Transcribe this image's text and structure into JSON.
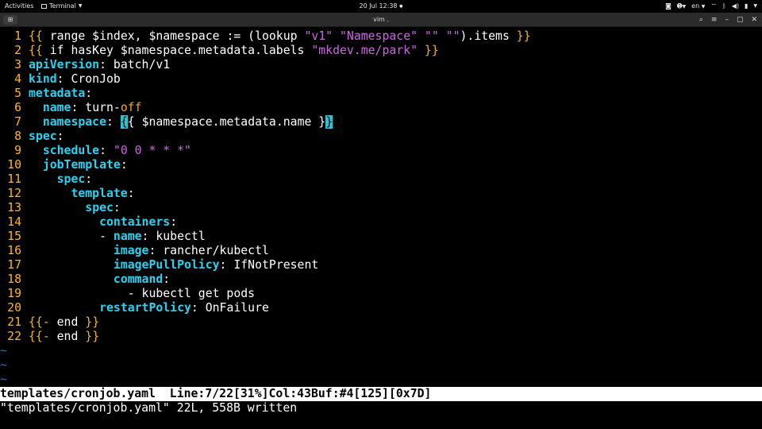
{
  "topbar": {
    "activities": "Activities",
    "app_menu": "Terminal",
    "clock": "20 Jul  12:38",
    "clock_dot": "●",
    "lang": "en"
  },
  "terminal": {
    "title": "vim ."
  },
  "editor": {
    "line_numbers": [
      "1",
      "2",
      "3",
      "4",
      "5",
      "6",
      "7",
      "8",
      "9",
      "10",
      "11",
      "12",
      "13",
      "14",
      "15",
      "16",
      "17",
      "18",
      "19",
      "20",
      "21",
      "22"
    ],
    "lines": [
      "{{ range $index, $namespace := (lookup \"v1\" \"Namespace\" \"\" \"\").items }}",
      "{{ if hasKey $namespace.metadata.labels \"mkdev.me/park\" }}",
      "apiVersion: batch/v1",
      "kind: CronJob",
      "metadata:",
      "  name: turn-off",
      "  namespace: {{ $namespace.metadata.name }}",
      "spec:",
      "  schedule: \"0 0 * * *\"",
      "  jobTemplate:",
      "    spec:",
      "      template:",
      "        spec:",
      "          containers:",
      "          - name: kubectl",
      "            image: rancher/kubectl",
      "            imagePullPolicy: IfNotPresent",
      "            command:",
      "              - kubectl get pods",
      "          restartPolicy: OnFailure",
      "{{- end }}",
      "{{- end }}"
    ],
    "tilde": "~"
  },
  "status": {
    "line": "templates/cronjob.yaml  Line:7/22[31%]Col:43Buf:#4[125][0x7D]",
    "message": "\"templates/cronjob.yaml\" 22L, 558B written"
  },
  "colors": {
    "background": "#000000",
    "line_number": "#ffb51e",
    "key": "#2bd2ef",
    "string": "#c969e0",
    "tilde": "#1f6fd1",
    "cursor_highlight": "#27c6d4"
  }
}
